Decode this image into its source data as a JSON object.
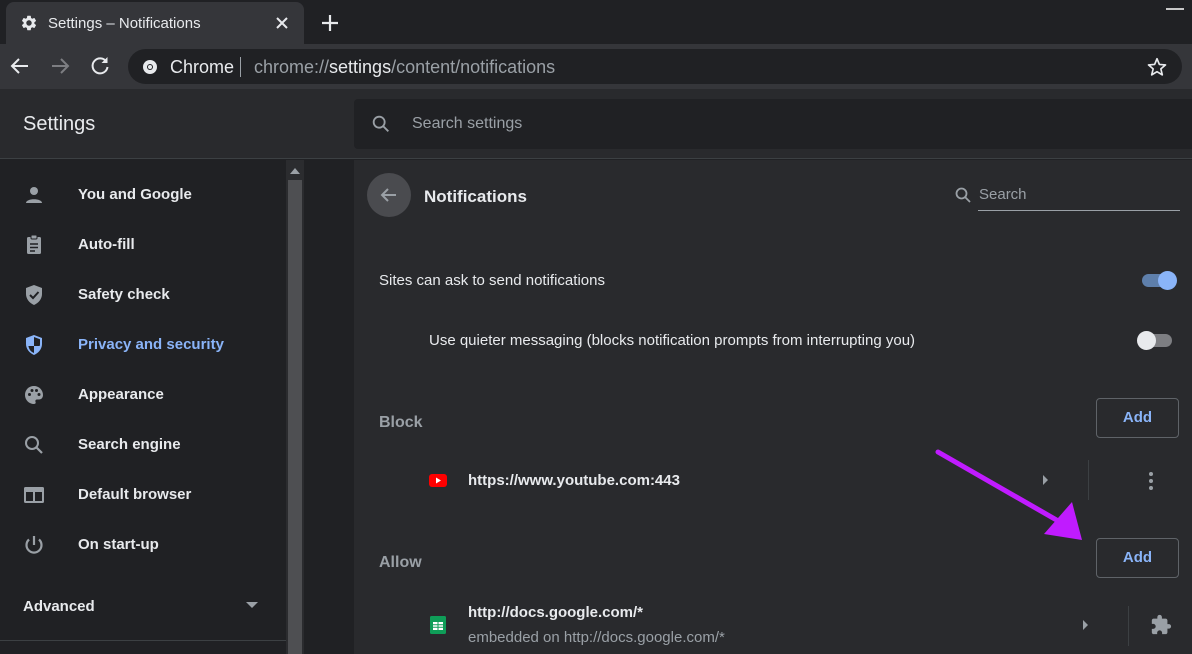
{
  "browser": {
    "tab_title": "Settings – Notifications",
    "omnibox_site": "Chrome",
    "url_prefix": "chrome://",
    "url_host": "settings",
    "url_path": "/content/notifications"
  },
  "header": {
    "title": "Settings",
    "search_placeholder": "Search settings"
  },
  "sidebar": {
    "items": [
      {
        "label": "You and Google",
        "icon": "person-icon"
      },
      {
        "label": "Auto-fill",
        "icon": "clipboard-icon"
      },
      {
        "label": "Safety check",
        "icon": "shield-check-icon"
      },
      {
        "label": "Privacy and security",
        "icon": "shield-icon",
        "active": true
      },
      {
        "label": "Appearance",
        "icon": "palette-icon"
      },
      {
        "label": "Search engine",
        "icon": "search-icon"
      },
      {
        "label": "Default browser",
        "icon": "browser-icon"
      },
      {
        "label": "On start-up",
        "icon": "power-icon"
      }
    ],
    "advanced": "Advanced"
  },
  "page": {
    "title": "Notifications",
    "search_placeholder": "Search",
    "sites_can_ask": "Sites can ask to send notifications",
    "sites_can_ask_on": true,
    "quieter": "Use quieter messaging (blocks notification prompts from interrupting you)",
    "quieter_on": false,
    "block": {
      "label": "Block",
      "add": "Add",
      "sites": [
        {
          "url": "https://www.youtube.com:443",
          "icon": "youtube-icon"
        }
      ]
    },
    "allow": {
      "label": "Allow",
      "add": "Add",
      "sites": [
        {
          "url": "http://docs.google.com/*",
          "sub": "embedded on http://docs.google.com/*",
          "icon": "sheets-icon"
        }
      ]
    }
  },
  "colors": {
    "accent": "#8ab4f8",
    "annotation_arrow": "#c01bff",
    "youtube": "#ff0000",
    "sheets": "#0f9d58"
  }
}
